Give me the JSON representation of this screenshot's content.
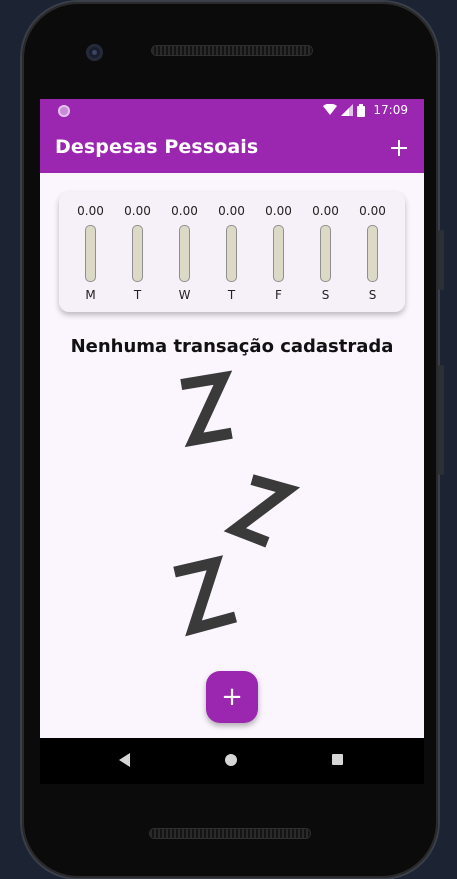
{
  "status_bar": {
    "time": "17:09"
  },
  "app_bar": {
    "title": "Despesas Pessoais",
    "add_icon": "plus-icon"
  },
  "chart_data": {
    "type": "bar",
    "categories": [
      "M",
      "T",
      "W",
      "T",
      "F",
      "S",
      "S"
    ],
    "values": [
      0.0,
      0.0,
      0.0,
      0.0,
      0.0,
      0.0,
      0.0
    ],
    "value_labels": [
      "0.00",
      "0.00",
      "0.00",
      "0.00",
      "0.00",
      "0.00",
      "0.00"
    ],
    "title": "",
    "xlabel": "",
    "ylabel": "",
    "ylim": [
      0,
      1
    ]
  },
  "empty_state": {
    "title": "Nenhuma transação cadastrada",
    "image": "zzz-sleeping-icon"
  },
  "fab": {
    "icon": "plus-icon",
    "label": "+"
  },
  "colors": {
    "primary": "#9b27b0",
    "background": "#fbf5fd",
    "bar_track": "#dcdac6"
  },
  "nav": {
    "back_icon": "back-icon",
    "home_icon": "home-icon",
    "recent_icon": "recent-apps-icon"
  }
}
